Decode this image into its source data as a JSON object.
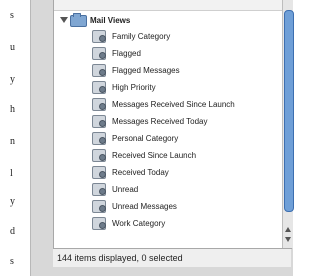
{
  "left_text": [
    "s",
    "u",
    "y",
    "h",
    "n",
    "l",
    "y",
    "d",
    "s"
  ],
  "tree": {
    "group_label": "Mail Views",
    "items": [
      "Family Category",
      "Flagged",
      "Flagged Messages",
      "High Priority",
      "Messages Received Since Launch",
      "Messages Received Today",
      "Personal Category",
      "Received Since Launch",
      "Received Today",
      "Unread",
      "Unread Messages",
      "Work Category"
    ]
  },
  "status": {
    "text": "144 items displayed, 0 selected"
  },
  "colors": {
    "panel_bg": "#d8d8d8",
    "scroll_thumb": "#6f9fd7"
  },
  "icons": {
    "group": "folder-icon",
    "item": "smart-folder-icon",
    "disclosure": "disclosure-triangle-icon"
  }
}
